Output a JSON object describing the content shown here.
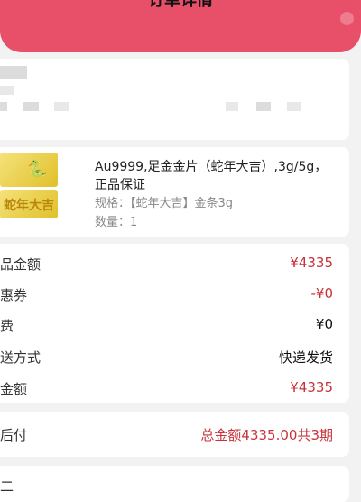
{
  "header": {
    "title": "订单详情"
  },
  "product": {
    "title": "Au9999,足金金片（蛇年大吉）,3g/5g，正品保证",
    "spec": "规格：【蛇年大吉】金条3g",
    "quantity": "数量：1",
    "thumbnail_text": "蛇年大吉"
  },
  "summary": {
    "rows": [
      {
        "label": "品金额",
        "value": "¥4335"
      },
      {
        "label": "惠券",
        "value": "-¥0"
      },
      {
        "label": "费",
        "value": "¥0"
      },
      {
        "label": "送方式",
        "value": "快递发货"
      },
      {
        "label": "金额",
        "value": "¥4335"
      }
    ]
  },
  "payment": {
    "label": "后付",
    "value": "总金额4335.00共3期"
  },
  "bottom": {
    "label": "二"
  },
  "colors": {
    "accent": "#e8506a",
    "price_red": "#c8323a"
  }
}
